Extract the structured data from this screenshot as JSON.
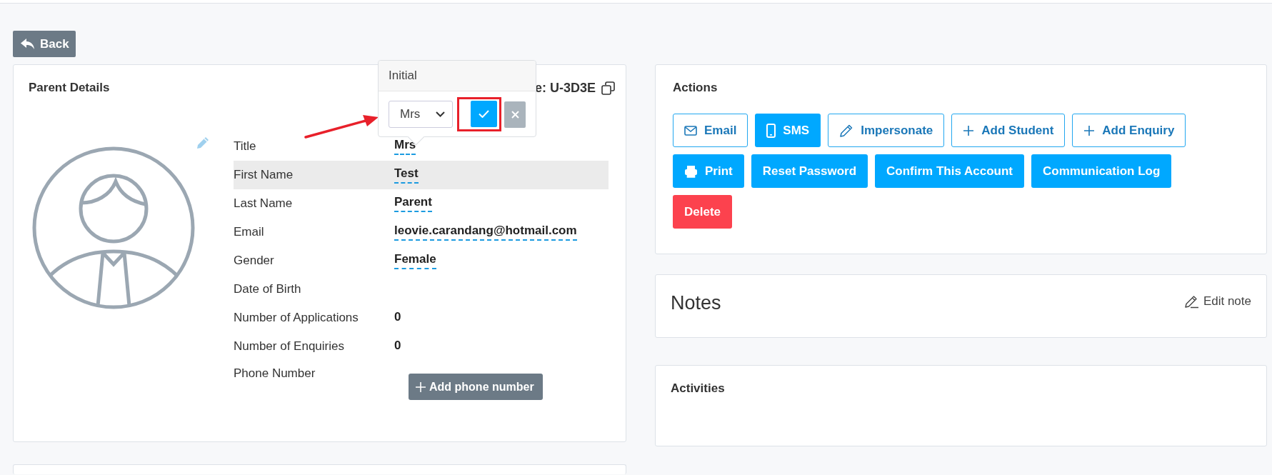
{
  "back_button": {
    "label": "Back"
  },
  "parent_details": {
    "title": "Parent Details",
    "reference_fragment": "e: U-3D3E",
    "fields": [
      {
        "kind": "text",
        "label": "Title",
        "value": "Mrs",
        "editable": true,
        "highlighted": false
      },
      {
        "kind": "text",
        "label": "First Name",
        "value": "Test",
        "editable": true,
        "highlighted": true
      },
      {
        "kind": "text",
        "label": "Last Name",
        "value": "Parent",
        "editable": true,
        "highlighted": false
      },
      {
        "kind": "text",
        "label": "Email",
        "value": "leovie.carandang@hotmail.com",
        "editable": true,
        "highlighted": false
      },
      {
        "kind": "text",
        "label": "Gender",
        "value": "Female",
        "editable": true,
        "highlighted": false
      },
      {
        "kind": "text",
        "label": "Date of Birth",
        "highlighted": false
      },
      {
        "kind": "text",
        "label": "Number of Applications",
        "value": "0",
        "editable": false,
        "highlighted": false
      },
      {
        "kind": "text",
        "label": "Number of Enquiries",
        "value": "0",
        "editable": false,
        "highlighted": false
      },
      {
        "kind": "button",
        "label": "Phone Number",
        "button": "Add phone number",
        "highlighted": false
      }
    ],
    "popover": {
      "title": "Initial",
      "select_value": "Mrs",
      "confirm_highlighted": true,
      "pointer_arrow": true
    }
  },
  "actions": {
    "title": "Actions",
    "buttons": [
      {
        "label": "Email",
        "kind": "outline"
      },
      {
        "label": "SMS",
        "kind": "filled"
      },
      {
        "label": "Impersonate",
        "kind": "outline"
      },
      {
        "label": "Add Student",
        "kind": "outline"
      },
      {
        "label": "Add Enquiry",
        "kind": "outline"
      },
      {
        "label": "Print",
        "kind": "filled"
      },
      {
        "label": "Reset Password",
        "kind": "filled"
      },
      {
        "label": "Confirm This Account",
        "kind": "filled"
      },
      {
        "label": "Communication Log",
        "kind": "filled"
      },
      {
        "label": "Delete",
        "kind": "danger"
      }
    ]
  },
  "notes": {
    "title": "Notes",
    "edit_link": "Edit note"
  },
  "activities": {
    "title": "Activities"
  }
}
